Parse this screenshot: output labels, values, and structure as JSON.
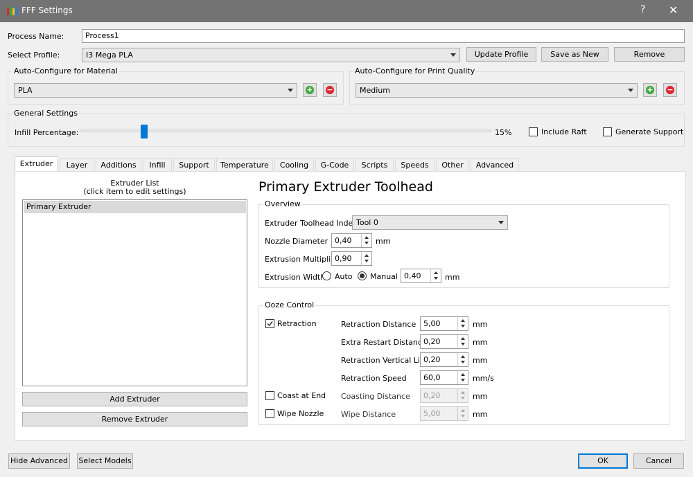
{
  "window": {
    "title": "FFF Settings",
    "help": "?",
    "close": "✕"
  },
  "process": {
    "label": "Process Name:",
    "value": "Process1"
  },
  "profile": {
    "label": "Select Profile:",
    "value": "I3 Mega PLA",
    "update": "Update Profile",
    "save_new": "Save as New",
    "remove": "Remove"
  },
  "material": {
    "title": "Auto-Configure for Material",
    "value": "PLA"
  },
  "quality": {
    "title": "Auto-Configure for Print Quality",
    "value": "Medium"
  },
  "general": {
    "title": "General Settings",
    "infill_label": "Infill Percentage:",
    "infill_value": "15%",
    "infill_level": 0.15,
    "raft": "Include Raft",
    "support": "Generate Support"
  },
  "tabs": [
    "Extruder",
    "Layer",
    "Additions",
    "Infill",
    "Support",
    "Temperature",
    "Cooling",
    "G-Code",
    "Scripts",
    "Speeds",
    "Other",
    "Advanced"
  ],
  "extruder_list": {
    "title": "Extruder List",
    "subtitle": "(click item to edit settings)",
    "items": [
      "Primary Extruder"
    ],
    "add": "Add Extruder",
    "remove": "Remove Extruder"
  },
  "toolhead": {
    "title": "Primary Extruder Toolhead",
    "overview": {
      "title": "Overview",
      "index_label": "Extruder Toolhead Index",
      "index_value": "Tool 0",
      "nozzle_label": "Nozzle Diameter",
      "nozzle_value": "0,40",
      "nozzle_unit": "mm",
      "mult_label": "Extrusion Multiplier",
      "mult_value": "0,90",
      "width_label": "Extrusion Width",
      "auto": "Auto",
      "manual": "Manual",
      "width_value": "0,40",
      "width_unit": "mm"
    },
    "ooze": {
      "title": "Ooze Control",
      "retraction": "Retraction",
      "coast": "Coast at End",
      "wipe": "Wipe Nozzle",
      "rows": [
        {
          "label": "Retraction Distance",
          "value": "5,00",
          "unit": "mm"
        },
        {
          "label": "Extra Restart Distance",
          "value": "0,20",
          "unit": "mm"
        },
        {
          "label": "Retraction Vertical Lift",
          "value": "0,20",
          "unit": "mm"
        },
        {
          "label": "Retraction Speed",
          "value": "60,0",
          "unit": "mm/s"
        },
        {
          "label": "Coasting Distance",
          "value": "0,20",
          "unit": "mm"
        },
        {
          "label": "Wipe Distance",
          "value": "5,00",
          "unit": "mm"
        }
      ]
    }
  },
  "footer": {
    "hide_advanced": "Hide Advanced",
    "select_models": "Select Models",
    "ok": "OK",
    "cancel": "Cancel"
  },
  "colors": {
    "titlebar": "#737373",
    "add": "#3aa83a",
    "remove": "#d9272e",
    "slider": "#0078d7"
  }
}
